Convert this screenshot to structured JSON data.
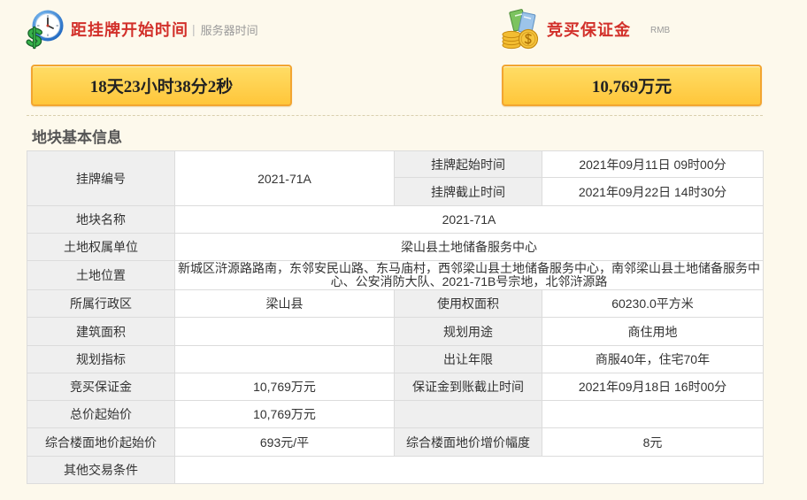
{
  "countdown": {
    "title": "距挂牌开始时间",
    "separator": "|",
    "subtitle": "服务器时间",
    "value": "18天23小时38分2秒",
    "icon": "clock-dollar-icon"
  },
  "deposit": {
    "title": "竞买保证金",
    "subtitle": "RMB",
    "value": "10,769万元",
    "icon": "coins-icon"
  },
  "colors": {
    "title_red": "#d2302a",
    "box_border": "#f2a531",
    "page_bg": "#fdf9ec",
    "label_bg": "#efefef"
  },
  "section_title": "地块基本信息",
  "fields": {
    "listing_no": {
      "label": "挂牌编号",
      "value": "2021-71A"
    },
    "start_time": {
      "label": "挂牌起始时间",
      "value": "2021年09月11日 09时00分"
    },
    "end_time": {
      "label": "挂牌截止时间",
      "value": "2021年09月22日 14时30分"
    },
    "parcel_name": {
      "label": "地块名称",
      "value": "2021-71A"
    },
    "owner": {
      "label": "土地权属单位",
      "value": "梁山县土地储备服务中心"
    },
    "location": {
      "label": "土地位置",
      "value": "新城区浒源路路南，东邻安民山路、东马庙村，西邻梁山县土地储备服务中心，南邻梁山县土地储备服务中心、公安消防大队、2021-71B号宗地，北邻浒源路"
    },
    "district": {
      "label": "所属行政区",
      "value": "梁山县"
    },
    "use_area": {
      "label": "使用权面积",
      "value": "60230.0平方米"
    },
    "building_area": {
      "label": "建筑面积"
    },
    "planned_use": {
      "label": "规划用途",
      "value": "商住用地"
    },
    "planning_index": {
      "label": "规划指标"
    },
    "term": {
      "label": "出让年限",
      "value": "商服40年，住宅70年"
    },
    "deposit": {
      "label": "竞买保证金",
      "value": "10,769万元"
    },
    "deposit_deadline": {
      "label": "保证金到账截止时间",
      "value": "2021年09月18日 16时00分"
    },
    "start_price": {
      "label": "总价起始价",
      "value": "10,769万元"
    },
    "floor_price": {
      "label": "综合楼面地价起始价",
      "value": "693元/平"
    },
    "floor_increment": {
      "label": "综合楼面地价增价幅度",
      "value": "8元"
    },
    "other_conditions": {
      "label": "其他交易条件"
    }
  }
}
